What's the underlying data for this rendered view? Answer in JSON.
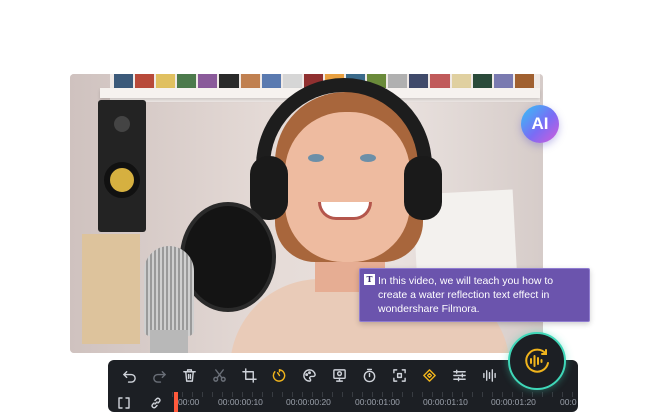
{
  "ai_badge": {
    "label": "AI"
  },
  "caption": {
    "icon": "text-caption-icon",
    "text": "In this video, we will teach you how to create a water reflection text effect in wondershare Filmora."
  },
  "toolbar": {
    "tools": [
      {
        "name": "undo-icon",
        "state": "enabled"
      },
      {
        "name": "redo-icon",
        "state": "disabled"
      },
      {
        "name": "delete-icon",
        "state": "enabled"
      },
      {
        "name": "cut-icon",
        "state": "disabled"
      },
      {
        "name": "crop-icon",
        "state": "enabled"
      },
      {
        "name": "speed-icon",
        "state": "active"
      },
      {
        "name": "color-palette-icon",
        "state": "enabled"
      },
      {
        "name": "ai-portrait-icon",
        "state": "enabled"
      },
      {
        "name": "timer-icon",
        "state": "enabled"
      },
      {
        "name": "fullscreen-icon",
        "state": "enabled"
      },
      {
        "name": "keyframe-icon",
        "state": "active"
      },
      {
        "name": "adjust-icon",
        "state": "enabled"
      },
      {
        "name": "audio-waveform-icon",
        "state": "enabled"
      }
    ]
  },
  "timeline": {
    "timecodes": [
      "00:00",
      "00:00:00:10",
      "00:00:00:20",
      "00:00:01:00",
      "00:00:01:10",
      "00:00:01:20",
      "00:0"
    ],
    "playhead_color": "#ff5a3c"
  },
  "colors": {
    "accent": "#f0b41c",
    "teal": "#3fd7b8",
    "caption_bg": "#6b54ad",
    "panel_bg": "#1c1f24"
  },
  "audio_button": {
    "icon": "audio-denoise-icon"
  }
}
